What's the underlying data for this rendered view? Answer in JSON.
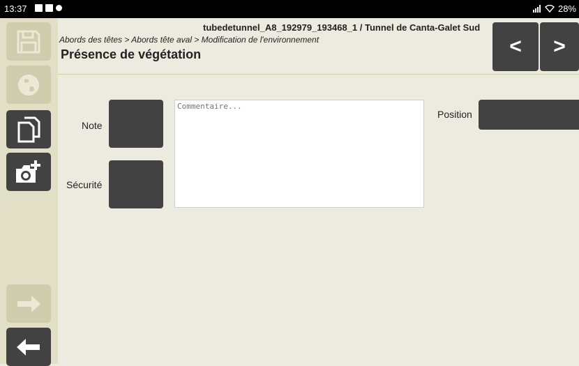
{
  "status_bar": {
    "time": "13:37",
    "battery": "28%"
  },
  "header": {
    "title": "tubedetunnel_A8_192979_193468_1 / Tunnel de Canta-Galet Sud",
    "breadcrumb": "Abords des têtes > Abords tête aval > Modification de l'environnement",
    "page_title": "Présence de végétation"
  },
  "nav": {
    "prev_label": "<",
    "next_label": ">"
  },
  "sidebar": {
    "buttons": [
      {
        "name": "save-icon",
        "enabled": false
      },
      {
        "name": "globe-icon",
        "enabled": false
      },
      {
        "name": "copy-icon",
        "enabled": true
      },
      {
        "name": "add-photo-icon",
        "enabled": true
      },
      {
        "name": "arrow-right-icon",
        "enabled": false
      },
      {
        "name": "arrow-left-icon",
        "enabled": true
      }
    ]
  },
  "form": {
    "note_label": "Note",
    "securite_label": "Sécurité",
    "comment_placeholder": "Commentaire...",
    "comment_value": "",
    "position_label": "Position"
  },
  "colors": {
    "background": "#ecebdf",
    "sidebar": "#e1dfc5",
    "dark_button": "#424242",
    "disabled_button": "#d0ccae"
  }
}
